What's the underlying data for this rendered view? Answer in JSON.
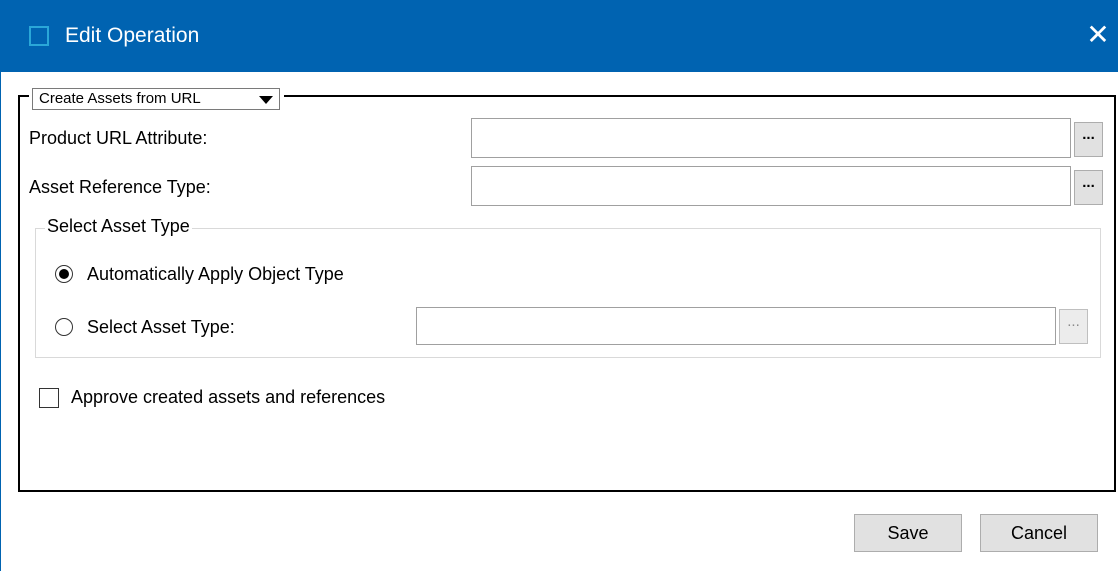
{
  "window": {
    "title": "Edit Operation",
    "close_glyph": "✕"
  },
  "operation": {
    "selected": "Create Assets from URL"
  },
  "form": {
    "product_url_label": "Product URL Attribute:",
    "product_url_value": "",
    "asset_ref_label": "Asset Reference Type:",
    "asset_ref_value": "",
    "browse_label": "..."
  },
  "asset_type_group": {
    "legend": "Select Asset Type",
    "auto_label": "Automatically Apply Object Type",
    "auto_checked": true,
    "select_label": "Select Asset Type:",
    "select_checked": false,
    "select_value": ""
  },
  "approve": {
    "label": "Approve created assets and references",
    "checked": false
  },
  "buttons": {
    "save": "Save",
    "cancel": "Cancel"
  },
  "icons": [
    "app-icon",
    "close-icon",
    "dropdown-arrow-icon"
  ]
}
